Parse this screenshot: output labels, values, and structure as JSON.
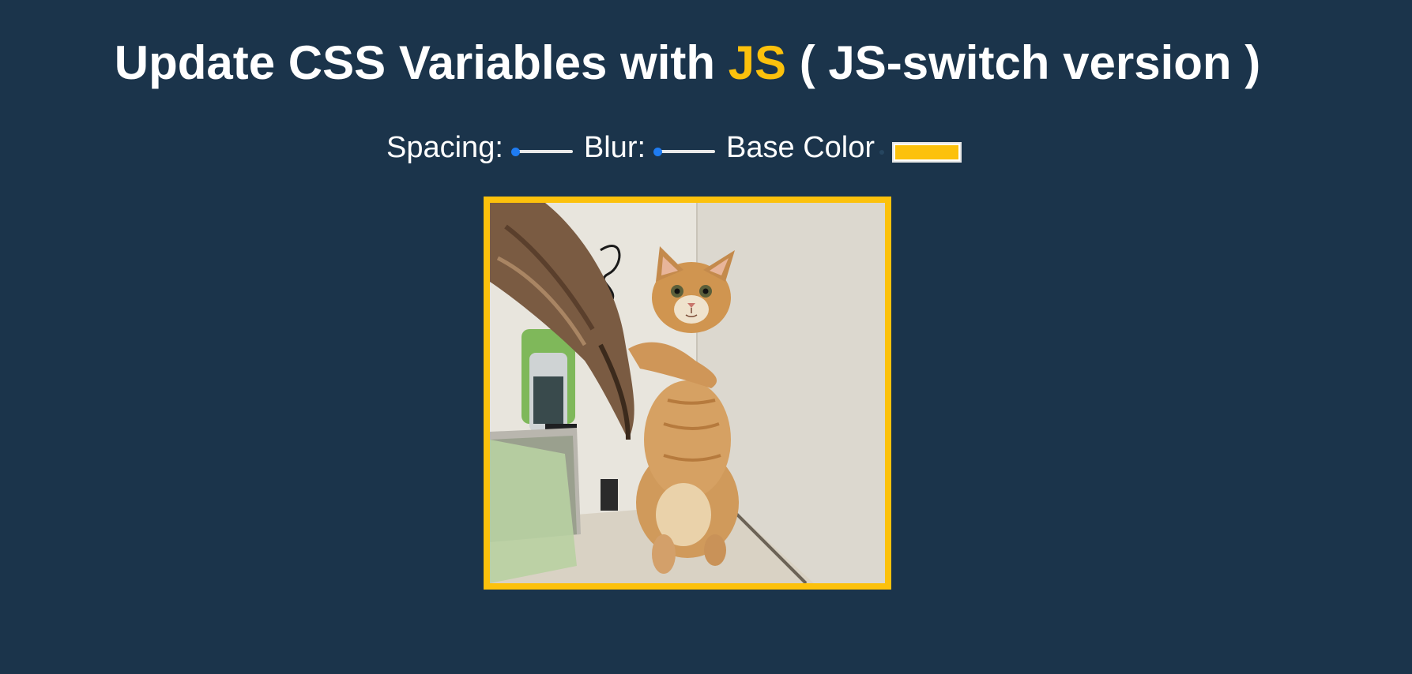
{
  "heading": {
    "prefix": "Update CSS Variables with ",
    "highlight": "JS",
    "suffix": " ( JS-switch version )"
  },
  "controls": {
    "spacing_label": "Spacing:",
    "spacing_value": 0,
    "blur_label": "Blur:",
    "blur_value": 0,
    "base_color_label": "Base Color",
    "base_color_value": "#fcc10c"
  },
  "image": {
    "alt_description": "orange-cat-holding-fish-toy"
  },
  "colors": {
    "background": "#1b344b",
    "accent": "#fcc10c",
    "slider_thumb": "#1f7cf2",
    "text": "#ffffff"
  }
}
